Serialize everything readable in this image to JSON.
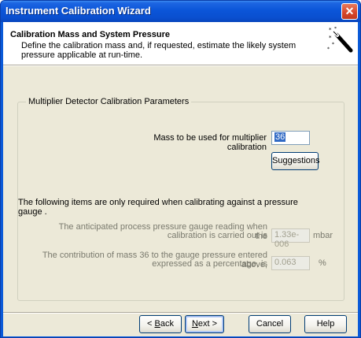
{
  "window": {
    "title": "Instrument Calibration Wizard",
    "close_glyph": "✕"
  },
  "header": {
    "title": "Calibration Mass and System Pressure",
    "description": "Define the calibration mass and, if requested, estimate the likely system pressure applicable at run-time."
  },
  "group": {
    "legend": "Multiplier Detector Calibration Parameters"
  },
  "mass": {
    "label": "Mass to be used for multiplier calibration",
    "value": "36"
  },
  "suggestions_label": "Suggestions",
  "pressure_note": "The following items are only required when calibrating against a pressure gauge .",
  "pressure": {
    "label_line1": "The anticipated process pressure gauge reading when the",
    "label_line2": "calibration is carried out is",
    "value": "1.33e-006",
    "unit": "mbar"
  },
  "contribution": {
    "label_line1": "The contribution of mass 36 to the gauge pressure entered above,",
    "label_line2": "expressed as a percentage, is",
    "value": "0.063",
    "unit": "%"
  },
  "buttons": {
    "back_prefix": "< ",
    "back_accel": "B",
    "back_rest": "ack",
    "next_accel": "N",
    "next_rest": "ext >",
    "cancel": "Cancel",
    "help": "Help"
  }
}
